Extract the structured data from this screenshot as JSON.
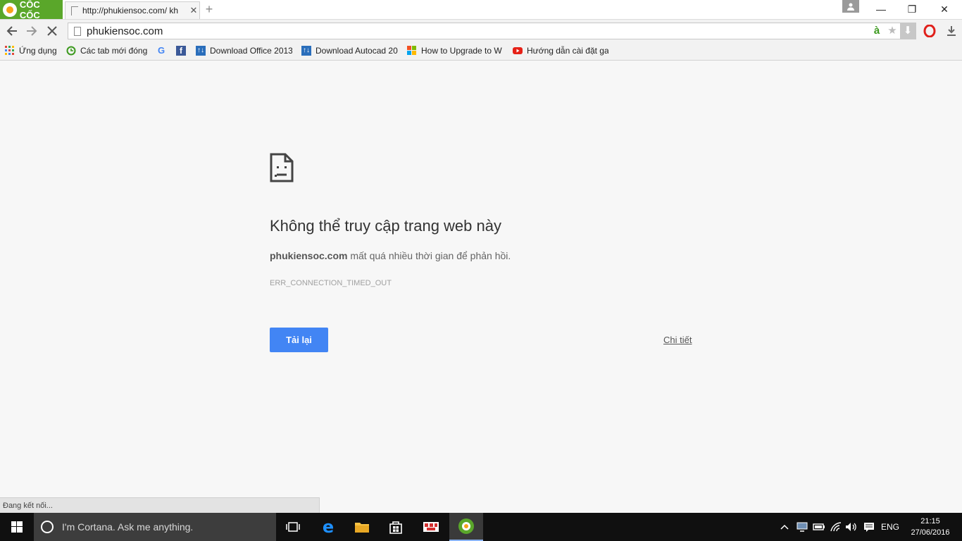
{
  "browser": {
    "brand": "CỐC CỐC",
    "tab": {
      "title": "http://phukiensoc.com/ kh",
      "close": "✕"
    },
    "new_tab": "+",
    "window": {
      "minimize": "—",
      "restore": "❐",
      "close": "✕"
    },
    "url": "phukiensoc.com"
  },
  "bookmarks": [
    {
      "label": "Ứng dụng",
      "icon": "apps-grid-icon"
    },
    {
      "label": "Các tab mới đóng",
      "icon": "recent-tabs-icon"
    },
    {
      "label": "",
      "icon": "google-icon"
    },
    {
      "label": "",
      "icon": "facebook-icon"
    },
    {
      "label": "Download Office 2013",
      "icon": "download-site-icon"
    },
    {
      "label": "Download Autocad 20",
      "icon": "download-site-icon"
    },
    {
      "label": "How to Upgrade to W",
      "icon": "windows-logo-icon"
    },
    {
      "label": "Hướng dẫn cài đặt ga",
      "icon": "youtube-icon"
    }
  ],
  "error": {
    "heading": "Không thể truy cập trang web này",
    "domain": "phukiensoc.com",
    "message": " mất quá nhiều thời gian để phản hồi.",
    "code": "ERR_CONNECTION_TIMED_OUT",
    "reload_label": "Tải lại",
    "details_label": "Chi tiết"
  },
  "status_text": "Đang kết nối...",
  "taskbar": {
    "cortana_placeholder": "I'm Cortana. Ask me anything.",
    "language": "ENG",
    "time": "21:15",
    "date": "27/06/2016"
  },
  "colors": {
    "brand_green": "#5aa72a",
    "reload_blue": "#4285f4",
    "taskbar": "#101010"
  }
}
